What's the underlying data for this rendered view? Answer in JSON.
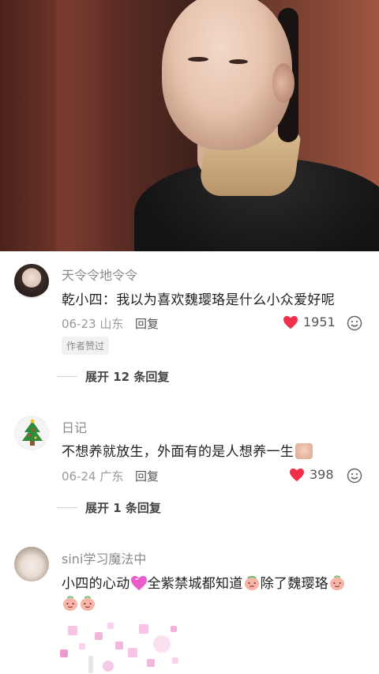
{
  "hero": {
    "icon": "portrait-photo"
  },
  "comments": [
    {
      "username": "天令令地令令",
      "text": "乾小四：我以为喜欢魏璎珞是什么小众爱好呢",
      "date": "06-23",
      "location": "山东",
      "reply_label": "回复",
      "likes": "1951",
      "badge": "作者赞过",
      "expand_label": "展开 12 条回复"
    },
    {
      "username": "日记",
      "text": "不想养就放生，外面有的是人想养一生",
      "date": "06-24",
      "location": "广东",
      "reply_label": "回复",
      "likes": "398",
      "expand_label": "展开 1 条回复"
    },
    {
      "username": "sini学习魔法中",
      "text_part1": "小四的心动",
      "text_part2": "全紫禁城都知道",
      "text_part3": "除了魏璎珞"
    }
  ],
  "colors": {
    "heart": "#f0304a",
    "text": "#1f1f1f",
    "meta": "#999999"
  }
}
